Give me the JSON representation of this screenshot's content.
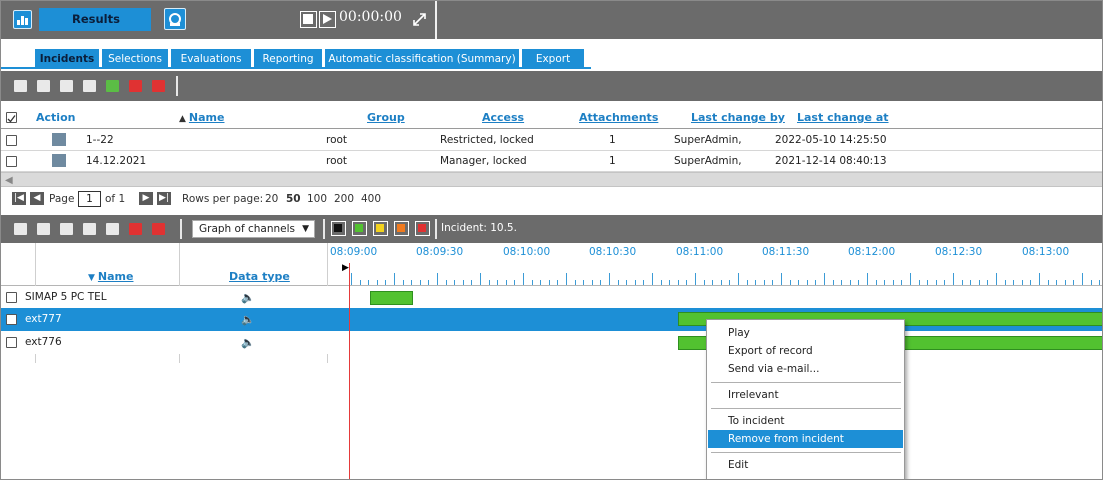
{
  "topbar": {
    "results_label": "Results",
    "time": "00:00:00",
    "icons": [
      "chart-icon",
      "camera-icon",
      "stop-icon",
      "play-icon",
      "expand-icon"
    ]
  },
  "tabs": [
    {
      "label": "Incidents",
      "active": true
    },
    {
      "label": "Selections",
      "active": false
    },
    {
      "label": "Evaluations",
      "active": false
    },
    {
      "label": "Reporting",
      "active": false
    },
    {
      "label": "Automatic classification (Summary)",
      "active": false
    },
    {
      "label": "Export",
      "active": false
    }
  ],
  "incidents_table": {
    "columns": {
      "action": "Action",
      "name": "Name",
      "group": "Group",
      "access": "Access",
      "attachments": "Attachments",
      "last_change_by": "Last change by",
      "last_change_at": "Last change at"
    },
    "rows": [
      {
        "name": "1--22",
        "group": "root",
        "access": "Restricted, locked",
        "attachments": "1",
        "last_change_by": "SuperAdmin,",
        "last_change_at": "2022-05-10 14:25:50"
      },
      {
        "name": "14.12.2021",
        "group": "root",
        "access": "Manager, locked",
        "attachments": "1",
        "last_change_by": "SuperAdmin,",
        "last_change_at": "2021-12-14 08:40:13"
      }
    ]
  },
  "pager": {
    "page_label": "Page",
    "page_value": "1",
    "of_label": "of 1",
    "rows_per_page_label": "Rows per page:",
    "options": [
      "20",
      "50",
      "100",
      "200",
      "400"
    ],
    "selected": "50"
  },
  "channels_toolbar": {
    "view_select": "Graph of channels",
    "incident_label": "Incident: 10.5.",
    "color_filters": [
      "#111111",
      "#52c230",
      "#f2d21e",
      "#f07a1e",
      "#e03232"
    ]
  },
  "timeline": {
    "times": [
      "08:09:00",
      "08:09:30",
      "08:10:00",
      "08:10:30",
      "08:11:00",
      "08:11:30",
      "08:12:00",
      "08:12:30",
      "08:13:00"
    ],
    "columns": {
      "name": "Name",
      "data_type": "Data type"
    }
  },
  "channels": [
    {
      "name": "SIMAP 5 PC TEL",
      "selected": false
    },
    {
      "name": "ext777",
      "selected": true
    },
    {
      "name": "ext776",
      "selected": false
    }
  ],
  "context_menu": {
    "items": [
      {
        "label": "Play"
      },
      {
        "label": "Export of record"
      },
      {
        "label": "Send via e-mail..."
      },
      {
        "label": "Irrelevant"
      },
      {
        "label": "To incident"
      },
      {
        "label": "Remove from incident",
        "highlighted": true
      },
      {
        "label": "Edit"
      }
    ]
  },
  "colors": {
    "accent": "#1d8fd6",
    "toolbar": "#6b6b6b",
    "bar_green": "#52c230",
    "cursor_red": "#e53a3a"
  }
}
